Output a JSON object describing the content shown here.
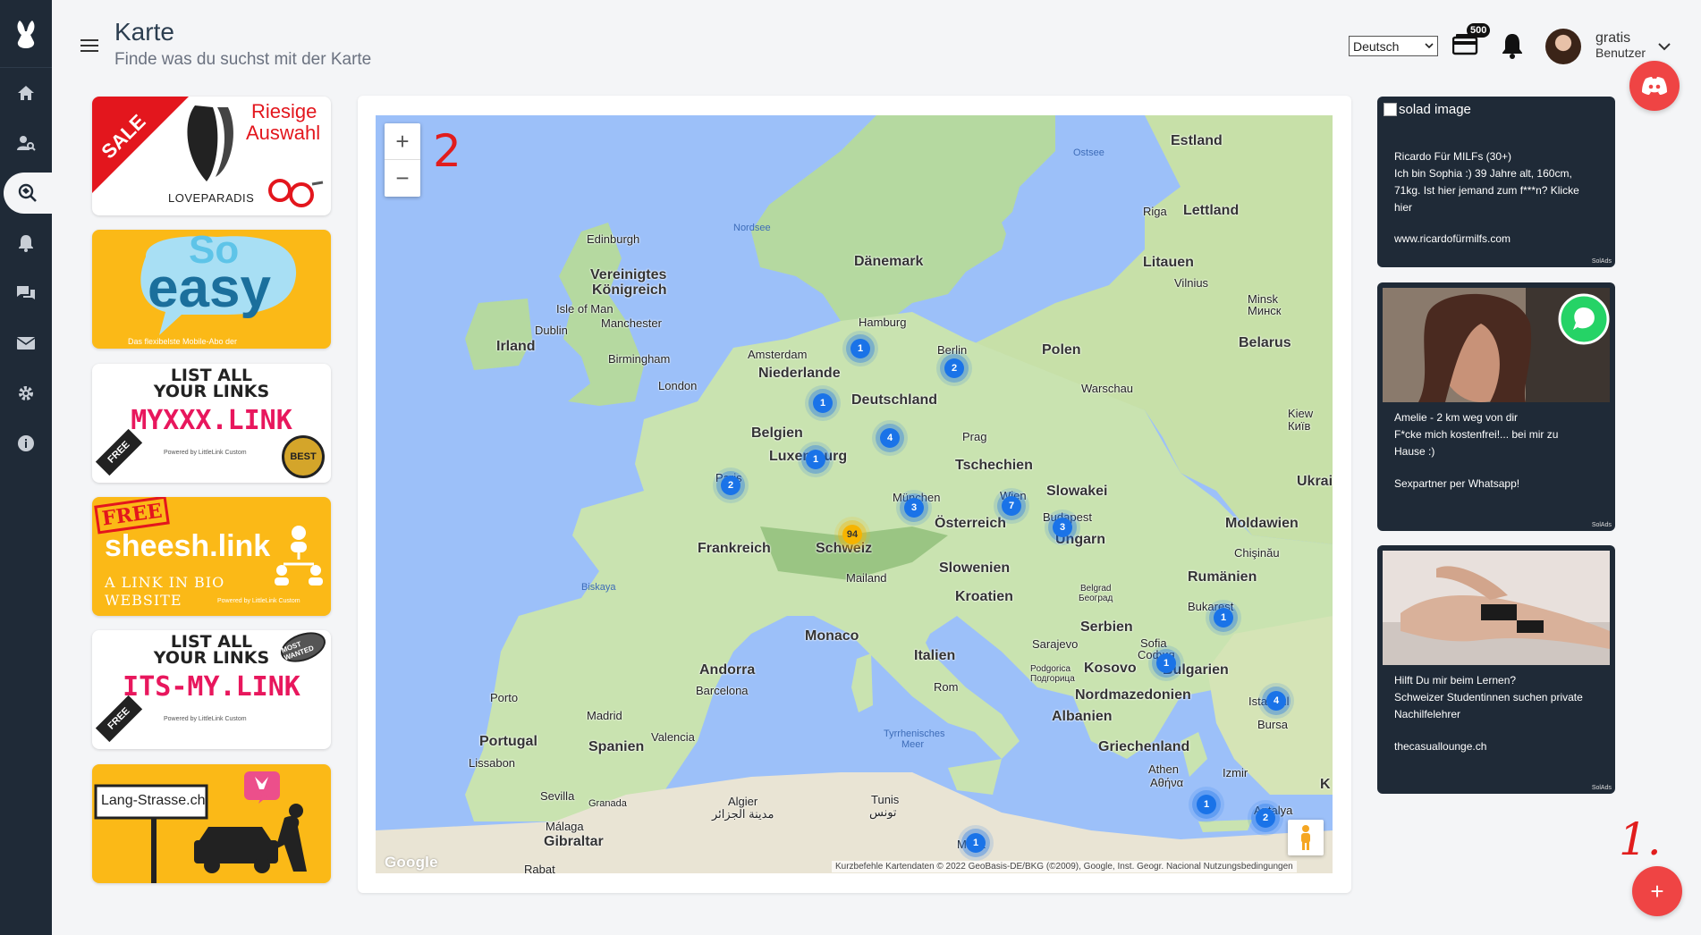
{
  "header": {
    "title": "Karte",
    "subtitle": "Finde was du suchst mit der Karte",
    "language": "Deutsch",
    "wallet_badge": "500",
    "user_name": "gratis",
    "user_role": "Benutzer"
  },
  "sidebar": {
    "items": [
      {
        "icon": "home-icon"
      },
      {
        "icon": "user-search-icon"
      },
      {
        "icon": "map-search-icon",
        "active": true
      },
      {
        "icon": "bell-icon"
      },
      {
        "icon": "chat-icon"
      },
      {
        "icon": "mail-icon"
      },
      {
        "icon": "gear-icon"
      },
      {
        "icon": "info-icon"
      }
    ]
  },
  "left_ads": {
    "ad1": {
      "sale": "SALE",
      "line1": "Riesige",
      "line2": "Auswahl",
      "brand": "LOVEPARADIS"
    },
    "ad2": {
      "line1": "So",
      "line2": "easy",
      "footer": "Das flexibelste Mobile-Abo der"
    },
    "ad3": {
      "line1": "LIST ALL",
      "line2": "YOUR LINKS",
      "url": "MYXXX.LINK",
      "tag": "FREE",
      "seal": "BEST",
      "powered": "Powered by LittleLink Custom"
    },
    "ad4": {
      "tag": "FREE",
      "brand": "sheesh.link",
      "line1": "A LINK IN BIO",
      "line2": "WEBSITE",
      "powered": "Powered by LittleLink Custom"
    },
    "ad5": {
      "line1": "LIST ALL",
      "line2": "YOUR LINKS",
      "url": "ITS-MY.LINK",
      "tag": "FREE",
      "seal": "MOST WANTED",
      "powered": "Powered by LittleLink Custom"
    },
    "ad6": {
      "sign": "Lang-Strasse.ch"
    }
  },
  "map": {
    "zoom_in": "+",
    "zoom_out": "−",
    "annotation": "2",
    "google": "Google",
    "attribution": "Kurzbefehle   Kartendaten © 2022 GeoBasis-DE/BKG (©2009), Google, Inst. Geogr. Nacional   Nutzungsbedingungen",
    "labels": {
      "estland": "Estland",
      "ostsee": "Ostsee",
      "riga": "Riga",
      "lettland": "Lettland",
      "edinburgh": "Edinburgh",
      "nordsee": "Nordsee",
      "vereinigtes": "Vereinigtes",
      "koenigreich": "Königreich",
      "daenemark": "Dänemark",
      "litauen": "Litauen",
      "vilnius": "Vilnius",
      "minsk": "Minsk",
      "minsk2": "Минск",
      "isle_of_man": "Isle of Man",
      "dublin": "Dublin",
      "manchester": "Manchester",
      "irland": "Irland",
      "hamburg": "Hamburg",
      "belarus": "Belarus",
      "amsterdam": "Amsterdam",
      "berlin": "Berlin",
      "polen": "Polen",
      "birmingham": "Birmingham",
      "niederlande": "Niederlande",
      "warschau": "Warschau",
      "london": "London",
      "deutschland": "Deutschland",
      "kiew": "Kiew",
      "kiew2": "Київ",
      "belgien": "Belgien",
      "prag": "Prag",
      "luxemburg": "Luxemburg",
      "tschechien": "Tschechien",
      "ukraine": "Ukrai",
      "paris": "Paris",
      "slowakei": "Slowakei",
      "muenchen": "München",
      "wien": "Wien",
      "moldawien": "Moldawien",
      "budapest": "Budapest",
      "oesterreich": "Österreich",
      "chisinau": "Chişinău",
      "frankreich": "Frankreich",
      "schweiz": "Schweiz",
      "ungarn": "Ungarn",
      "biskaya": "Biskaya",
      "slowenien": "Slowenien",
      "mailand": "Mailand",
      "rumaenien": "Rumänien",
      "kroatien": "Kroatien",
      "belgrad": "Belgrad",
      "belgrad2": "Београд",
      "bukarest": "Bukarest",
      "monaco": "Monaco",
      "serbien": "Serbien",
      "sarajevo": "Sarajevo",
      "sofia": "Sofia",
      "sofia2": "София",
      "andorra": "Andorra",
      "italien": "Italien",
      "bulgarien": "Bulgarien",
      "kosovo": "Kosovo",
      "podgorica": "Podgorica",
      "podgorica2": "Подгорица",
      "barcelona": "Barcelona",
      "rom": "Rom",
      "nordmazedonien": "Nordmazedonien",
      "porto": "Porto",
      "albanien": "Albanien",
      "istanbul": "Istanbul",
      "bursa": "Bursa",
      "madrid": "Madrid",
      "tyrrhenisches": "Tyrrhenisches",
      "meer": "Meer",
      "portugal": "Portugal",
      "spanien": "Spanien",
      "valencia": "Valencia",
      "griechenland": "Griechenland",
      "lissabon": "Lissabon",
      "athen": "Athen",
      "athen2": "Αθήνα",
      "izmir": "Izmir",
      "sevilla": "Sevilla",
      "granada": "Granada",
      "algier": "Algier",
      "algier2": "مدينة الجزائر",
      "tunis": "Tunis",
      "tunis2": "تونس",
      "antalya": "Antalya",
      "malaga": "Málaga",
      "gibraltar": "Gibraltar",
      "malta": "Malta",
      "rabat": "Rabat",
      "k": "K"
    },
    "clusters": [
      {
        "count": "1"
      },
      {
        "count": "2"
      },
      {
        "count": "1"
      },
      {
        "count": "4"
      },
      {
        "count": "1"
      },
      {
        "count": "2"
      },
      {
        "count": "3"
      },
      {
        "count": "7"
      },
      {
        "count": "3"
      },
      {
        "count": "94"
      },
      {
        "count": "1"
      },
      {
        "count": "1"
      },
      {
        "count": "4"
      },
      {
        "count": "1"
      },
      {
        "count": "2"
      },
      {
        "count": "1"
      }
    ]
  },
  "right_ads": {
    "ad1": {
      "alt": "solad image",
      "l1": "Ricardo Für MILFs (30+)",
      "l2": "Ich bin Sophia :) 39 Jahre alt, 160cm,",
      "l3": "71kg. Ist hier jemand zum f***n? Klicke",
      "l4": "hier",
      "url": "www.ricardofürmilfs.com",
      "solads": "SolAds"
    },
    "ad2": {
      "l1": "Amelie - 2 km weg von dir",
      "l2": "F*cke mich kostenfrei!... bei mir zu",
      "l3": "Hause :)",
      "url": "Sexpartner per Whatsapp!",
      "solads": "SolAds"
    },
    "ad3": {
      "l1": "Hilft Du mir beim Lernen?",
      "l2": "Schweizer Studentinnen suchen private",
      "l3": "Nachilfelehrer",
      "url": "thecasuallounge.ch",
      "solads": "SolAds"
    }
  },
  "fab": {
    "label": "+",
    "annotation": "1."
  },
  "colors": {
    "accent": "#ef4444",
    "sidebar": "#1f2a37",
    "ad_yellow": "#fbb917",
    "cluster": "#1a73e8"
  }
}
